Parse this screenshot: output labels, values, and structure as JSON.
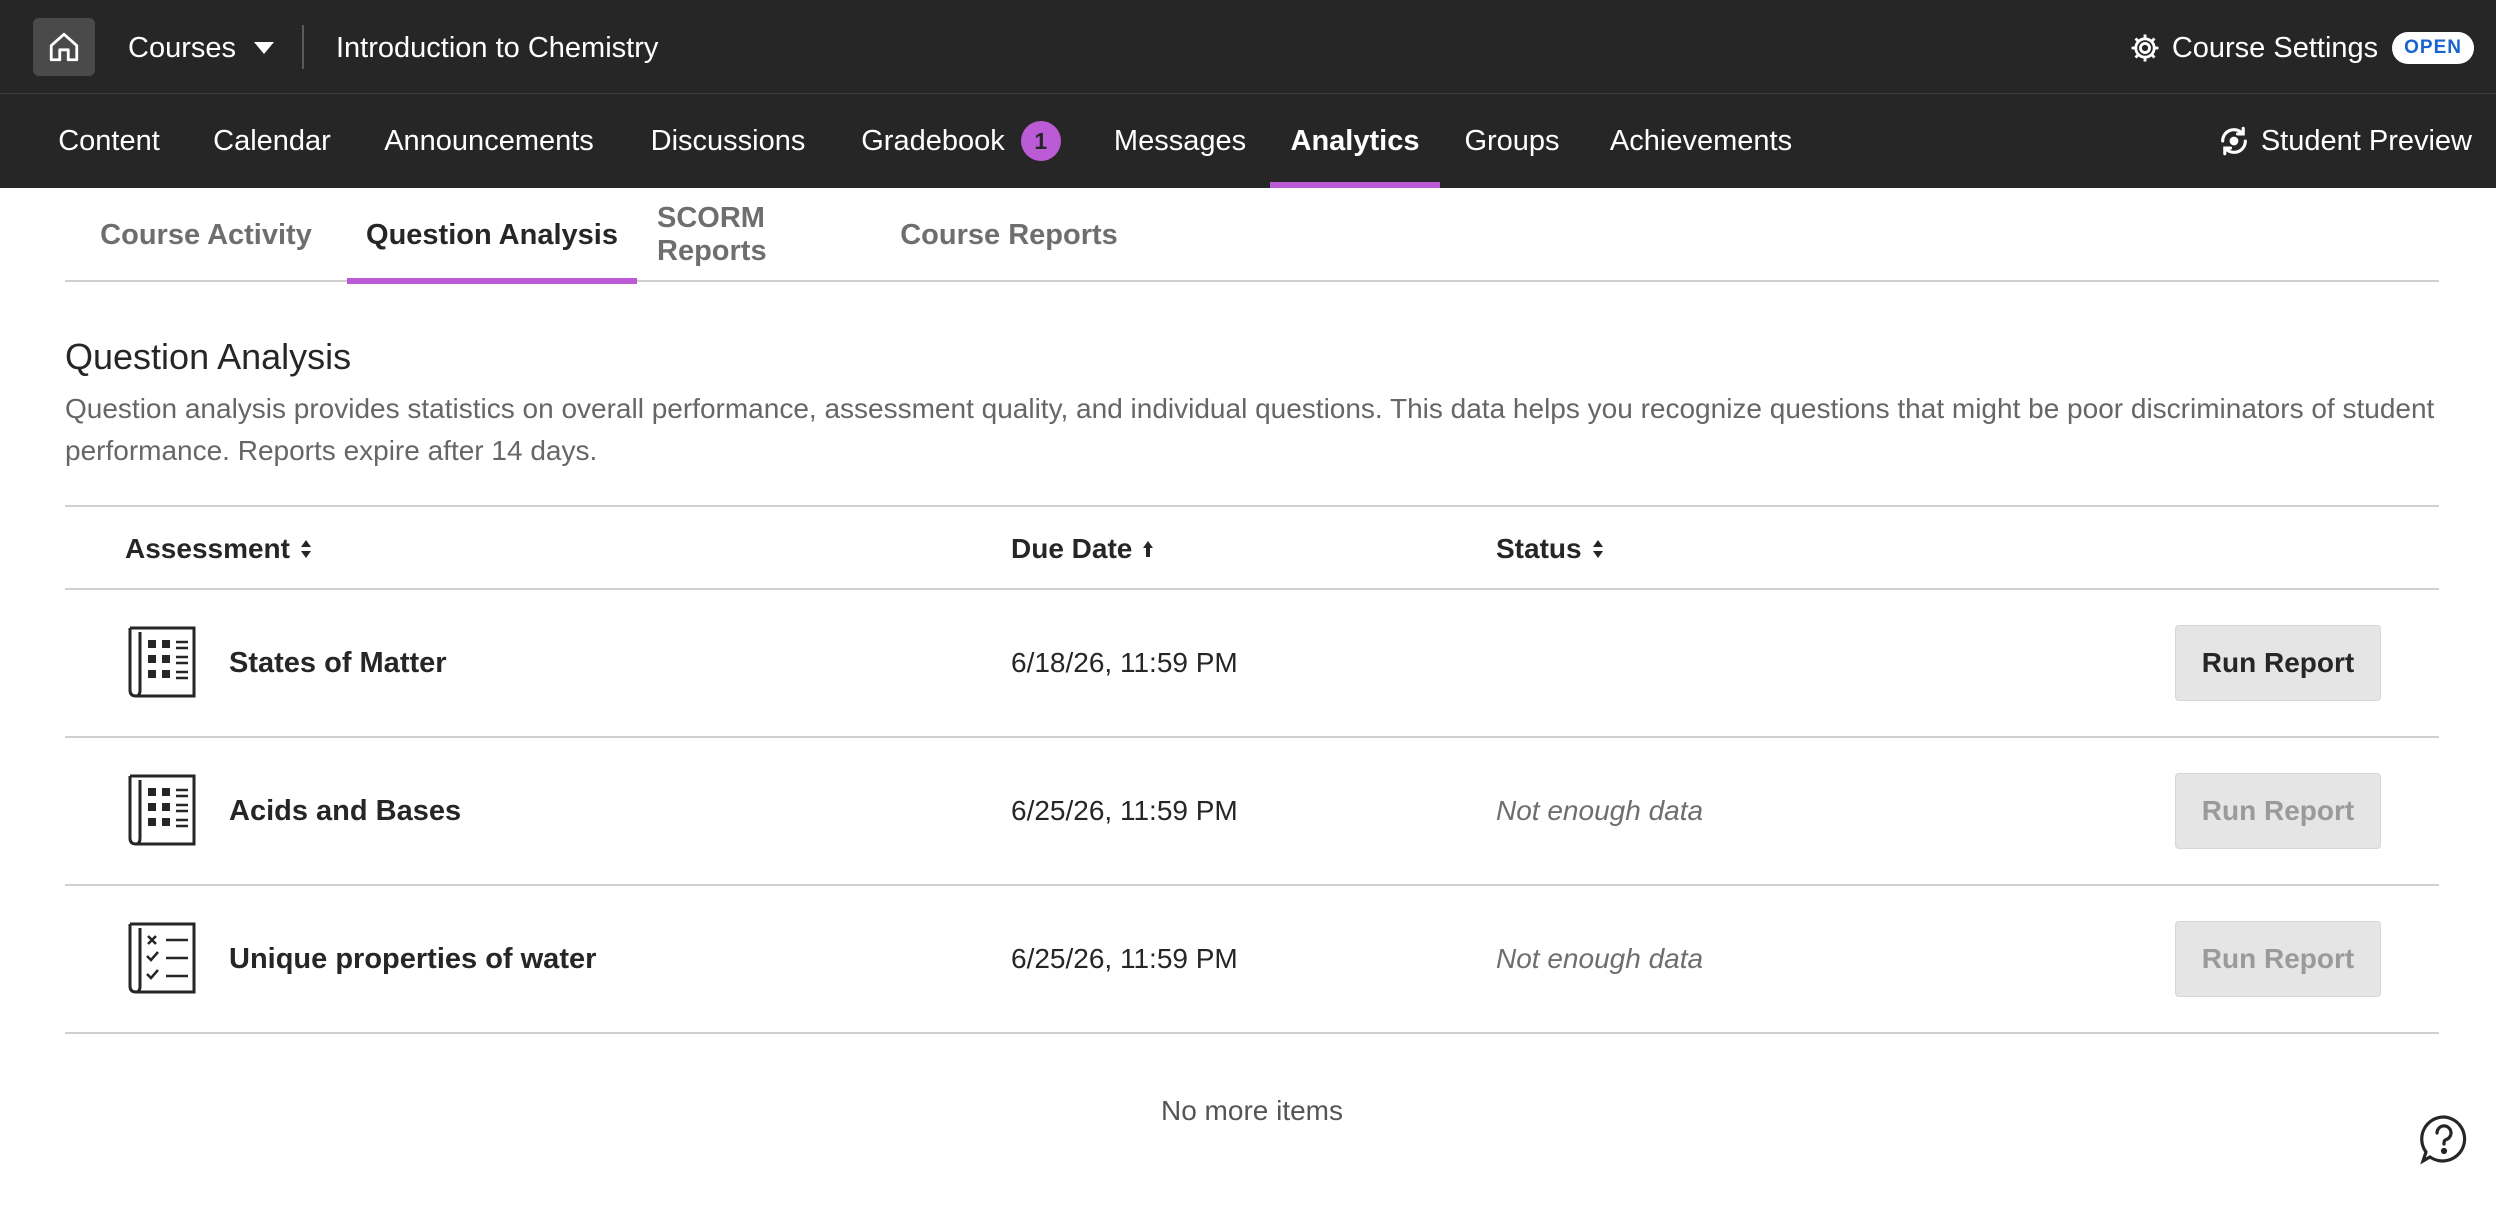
{
  "topbar": {
    "courses_label": "Courses",
    "course_title": "Introduction to Chemistry",
    "settings_label": "Course Settings",
    "open_badge": "OPEN"
  },
  "nav": {
    "items": [
      {
        "label": "Content"
      },
      {
        "label": "Calendar"
      },
      {
        "label": "Announcements"
      },
      {
        "label": "Discussions"
      },
      {
        "label": "Gradebook",
        "badge": "1"
      },
      {
        "label": "Messages"
      },
      {
        "label": "Analytics",
        "active": true
      },
      {
        "label": "Groups"
      },
      {
        "label": "Achievements"
      }
    ],
    "student_preview": "Student Preview"
  },
  "subtabs": [
    {
      "label": "Course Activity"
    },
    {
      "label": "Question Analysis",
      "active": true
    },
    {
      "label": "SCORM Reports"
    },
    {
      "label": "Course Reports"
    }
  ],
  "main": {
    "title": "Question Analysis",
    "description": "Question analysis provides statistics on overall performance, assessment quality, and individual questions. This data helps you recognize questions that might be poor discriminators of student performance. Reports expire after 14 days.",
    "columns": {
      "assessment": "Assessment",
      "due_date": "Due Date",
      "status": "Status"
    },
    "rows": [
      {
        "name": "States of Matter",
        "due": "6/18/26, 11:59 PM",
        "status": "",
        "button": "Run Report",
        "icon": "test-icon"
      },
      {
        "name": "Acids and Bases",
        "due": "6/25/26, 11:59 PM",
        "status": "Not enough data",
        "button": "Run Report",
        "icon": "test-icon"
      },
      {
        "name": "Unique properties of water",
        "due": "6/25/26, 11:59 PM",
        "status": "Not enough data",
        "button": "Run Report",
        "icon": "checklist-icon"
      }
    ],
    "no_more": "No more items"
  },
  "colors": {
    "topbar_bg": "#262626",
    "accent": "#bc5bd6",
    "open_badge_text": "#1863cf"
  }
}
